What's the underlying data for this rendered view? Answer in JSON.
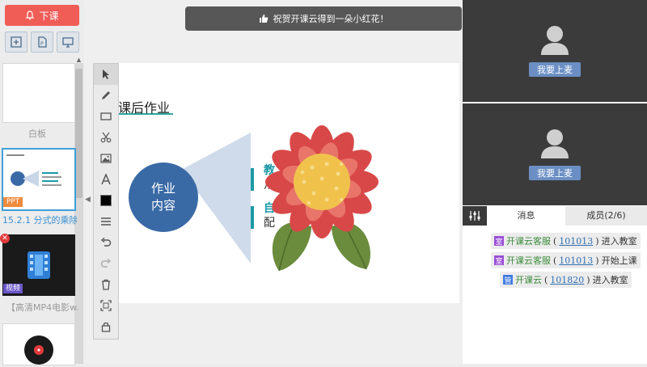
{
  "left_panel": {
    "end_class_label": "下课",
    "tools": [
      "add-slide-icon",
      "ppt-file-icon",
      "screen-share-icon"
    ],
    "items": [
      {
        "label": "白板",
        "badge": ""
      },
      {
        "label": "15.2.1 分式的乘除.",
        "badge": "PPT"
      },
      {
        "label": "【高清MP4电影w.",
        "badge": "视频"
      }
    ]
  },
  "notification": "祝贺开课云得到一朵小红花！",
  "slide": {
    "title": "课后作业",
    "circle_line1": "作业",
    "circle_line2": "内容",
    "item1_head": "教",
    "item1_text": "从",
    "item2_head": "自",
    "item2_text": "配"
  },
  "toolbar": [
    "pointer",
    "pen",
    "rectangle",
    "scissors",
    "image",
    "text",
    "color",
    "lines",
    "undo",
    "redo",
    "delete",
    "fullscreen",
    "lock"
  ],
  "video_panels": [
    {
      "button": "我要上麦"
    },
    {
      "button": "我要上麦"
    }
  ],
  "tabs": {
    "messages": "消息",
    "members": "成员(2/6)"
  },
  "messages": [
    {
      "badge": "室",
      "name": "开课云客服",
      "id": "101013",
      "action": "进入教室",
      "badge_color": "#9a4fd6"
    },
    {
      "badge": "室",
      "name": "开课云客服",
      "id": "101013",
      "action": "开始上课",
      "badge_color": "#9a4fd6"
    },
    {
      "badge": "管",
      "name": "开课云",
      "id": "101820",
      "action": "进入教室",
      "badge_color": "#3f7be0"
    }
  ],
  "colors": {
    "end_button": "#f05d57",
    "mic_button": "#6b8fc4",
    "circle": "#3a6aa6",
    "teal": "#1b9aa6"
  }
}
